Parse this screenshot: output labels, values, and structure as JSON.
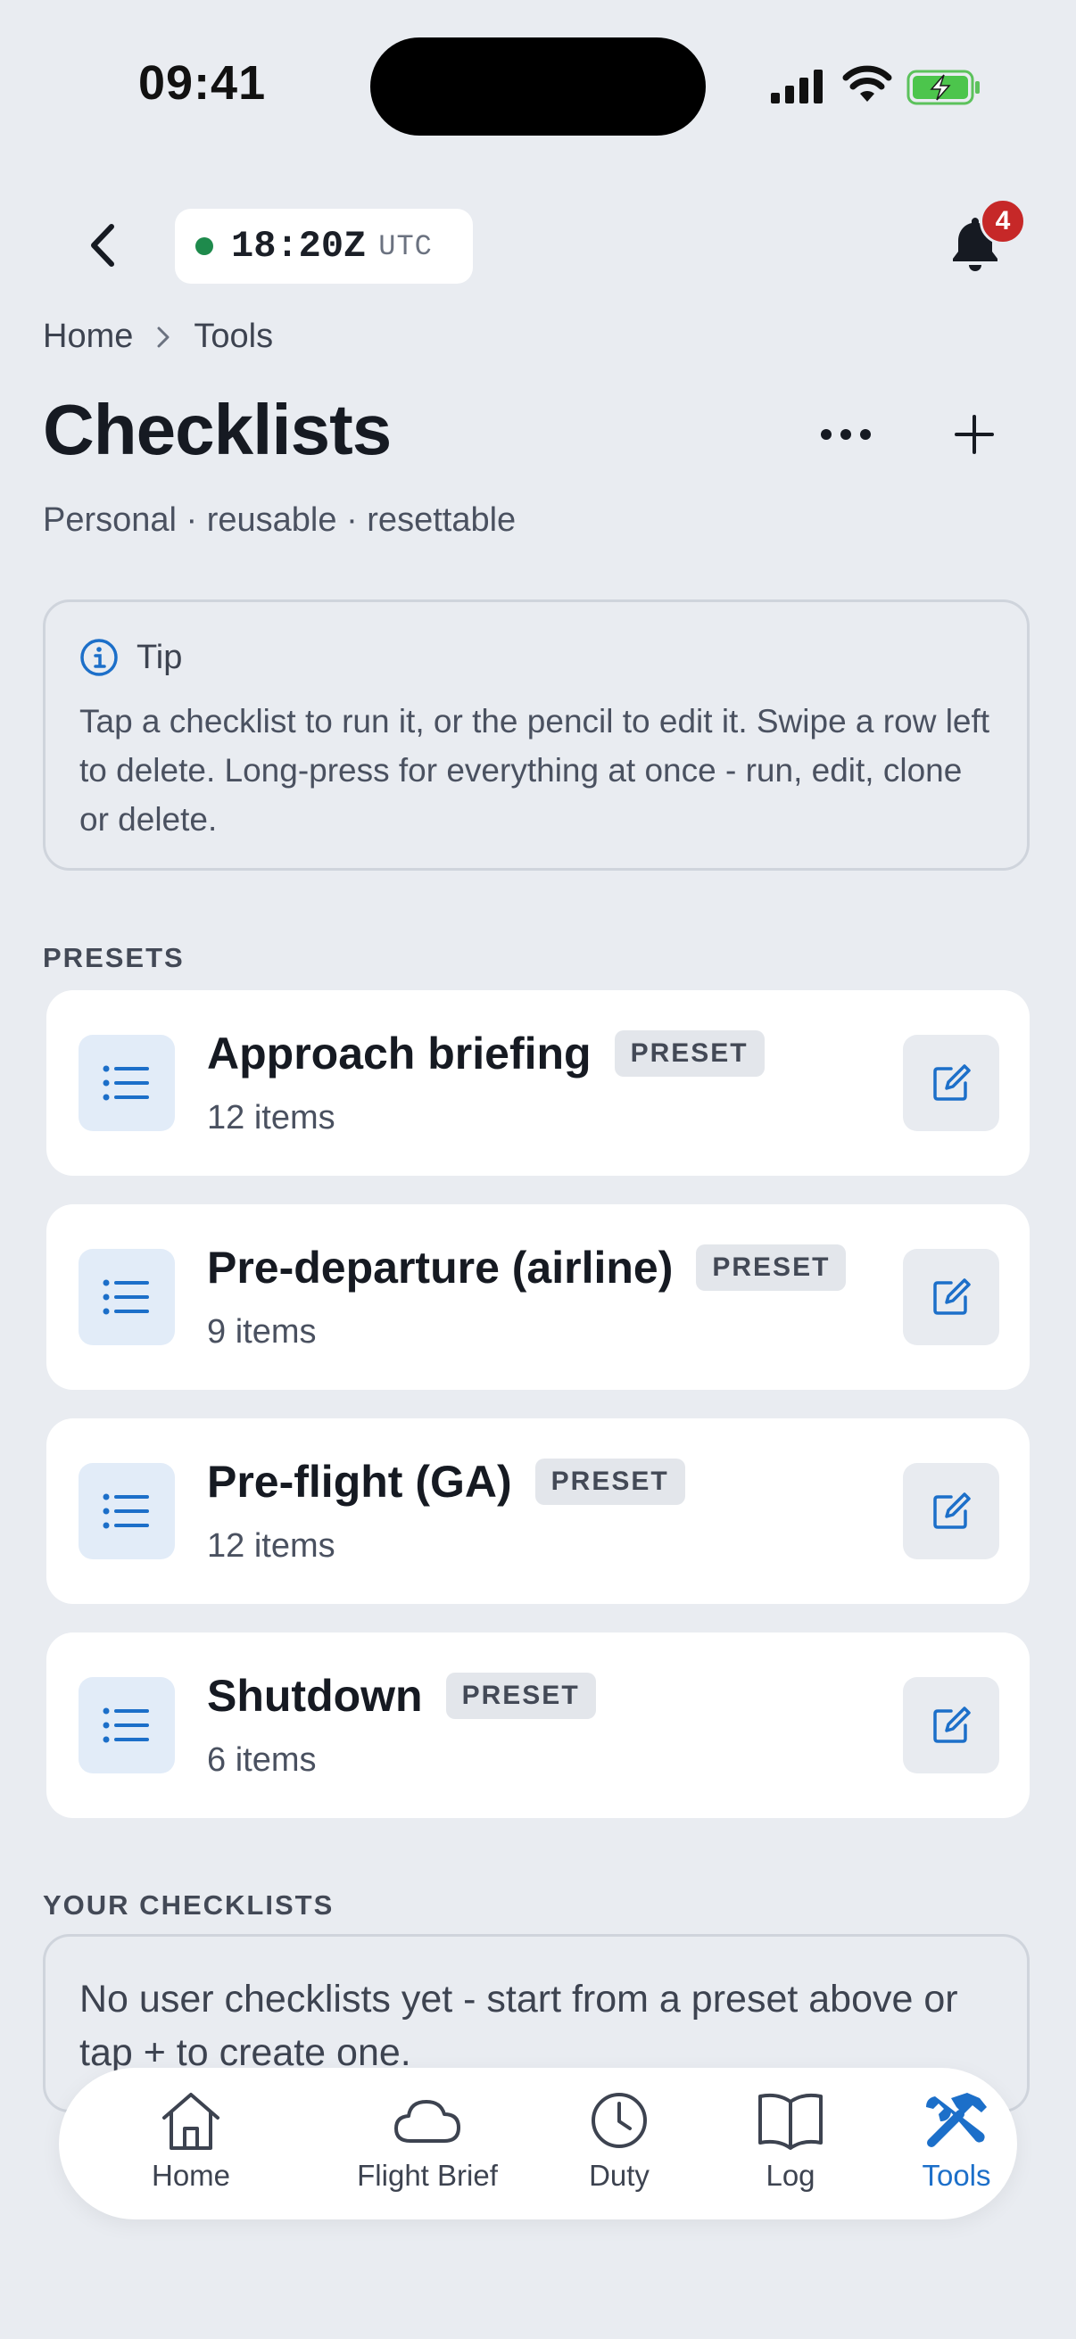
{
  "status_bar": {
    "time": "09:41"
  },
  "header": {
    "utc_time": "18:20Z",
    "utc_label": "UTC",
    "notification_count": "4"
  },
  "breadcrumb": [
    "Home",
    "Tools"
  ],
  "page": {
    "title": "Checklists",
    "subtitle": "Personal · reusable · resettable"
  },
  "tip": {
    "title": "Tip",
    "body": "Tap a checklist to run it, or the pencil to edit it. Swipe a row left to delete. Long-press for everything at once - run, edit, clone or delete."
  },
  "presets": {
    "label": "PRESETS",
    "items": [
      {
        "title": "Approach briefing",
        "badge": "PRESET",
        "count": "12 items"
      },
      {
        "title": "Pre-departure (airline)",
        "badge": "PRESET",
        "count": "9 items"
      },
      {
        "title": "Pre-flight (GA)",
        "badge": "PRESET",
        "count": "12 items"
      },
      {
        "title": "Shutdown",
        "badge": "PRESET",
        "count": "6 items"
      }
    ]
  },
  "user_checklists": {
    "label": "YOUR CHECKLISTS",
    "empty_text": "No user checklists yet - start from a preset above or tap + to create one."
  },
  "tabs": [
    {
      "label": "Home",
      "icon": "house-icon",
      "active": false
    },
    {
      "label": "Flight Brief",
      "icon": "cloud-icon",
      "active": false
    },
    {
      "label": "Duty",
      "icon": "clock-icon",
      "active": false
    },
    {
      "label": "Log",
      "icon": "book-icon",
      "active": false
    },
    {
      "label": "Tools",
      "icon": "tools-icon",
      "active": true
    }
  ],
  "colors": {
    "background": "#e9ecf1",
    "accent": "#1c6fc9",
    "badge_red": "#c62828",
    "utc_dot_green": "#1e8a4c"
  }
}
